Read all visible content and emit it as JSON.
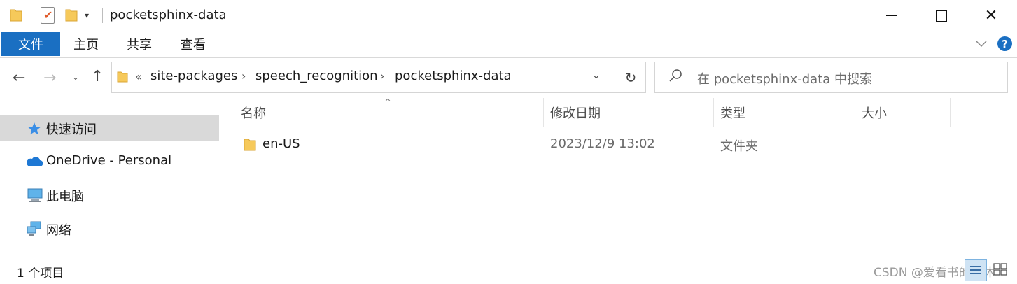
{
  "window": {
    "title": "pocketsphinx-data",
    "minimize_label": "",
    "close_glyph": "✕"
  },
  "quick_access_toolbar": {
    "dropdown_glyph": "▾"
  },
  "ribbon": {
    "tabs": [
      "文件",
      "主页",
      "共享",
      "查看"
    ],
    "active_tab": "文件",
    "help_glyph": "?",
    "accent": "#1a6fc2"
  },
  "nav": {
    "back_glyph": "←",
    "forward_glyph": "→",
    "recent_glyph": "⌄",
    "up_glyph": "↑"
  },
  "address_bar": {
    "overflow_glyph": "«",
    "crumbs": [
      "site-packages",
      "speech_recognition",
      "pocketsphinx-data"
    ],
    "separator_glyph": "›",
    "dropdown_glyph": "⌄",
    "refresh_glyph": "↻"
  },
  "search": {
    "placeholder": "在 pocketsphinx-data 中搜索"
  },
  "sidebar": {
    "items": [
      {
        "label": "快速访问",
        "icon": "star-icon",
        "selected": true
      },
      {
        "label": "OneDrive - Personal",
        "icon": "cloud-icon",
        "selected": false
      },
      {
        "label": "此电脑",
        "icon": "computer-icon",
        "selected": false
      },
      {
        "label": "网络",
        "icon": "network-icon",
        "selected": false
      }
    ]
  },
  "file_list": {
    "columns": [
      "名称",
      "修改日期",
      "类型",
      "大小"
    ],
    "sort_glyph": "^",
    "rows": [
      {
        "name": "en-US",
        "modified": "2023/12/9 13:02",
        "type": "文件夹",
        "size": ""
      }
    ]
  },
  "status_bar": {
    "item_count": "1 个项目"
  },
  "watermark": "CSDN @爱看书的小沐"
}
